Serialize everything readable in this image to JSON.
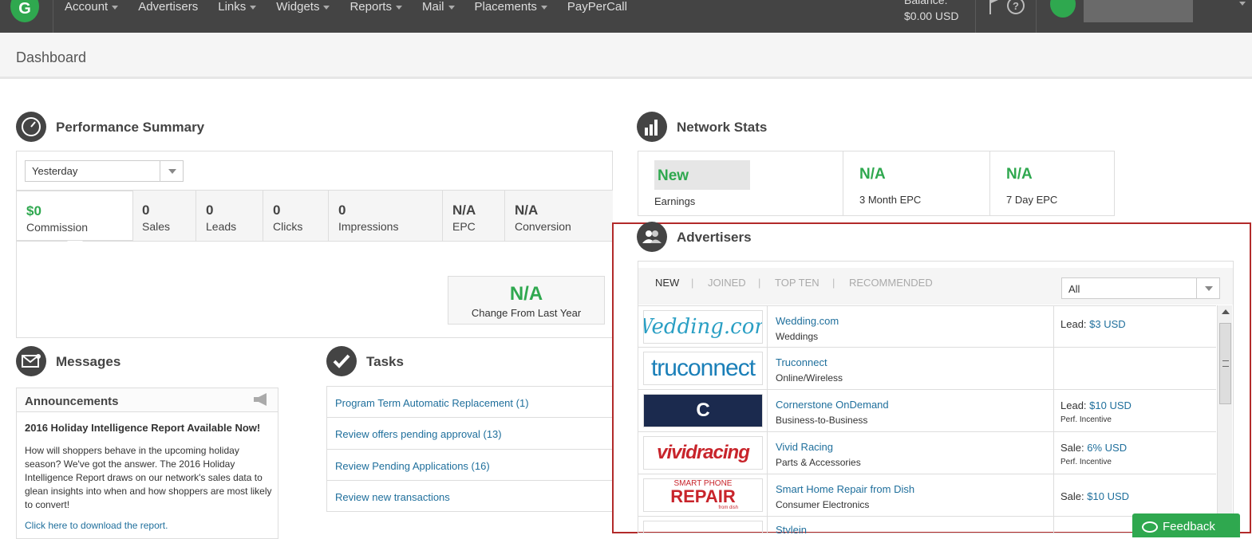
{
  "app": {
    "logo_glyph": "G",
    "brand_color": "#2fa84f"
  },
  "topnav": {
    "items": [
      {
        "label": "Account",
        "dropdown": true
      },
      {
        "label": "Advertisers",
        "dropdown": false
      },
      {
        "label": "Links",
        "dropdown": true
      },
      {
        "label": "Widgets",
        "dropdown": true
      },
      {
        "label": "Reports",
        "dropdown": true
      },
      {
        "label": "Mail",
        "dropdown": true
      },
      {
        "label": "Placements",
        "dropdown": true
      },
      {
        "label": "PayPerCall",
        "dropdown": false
      }
    ],
    "balance_label": "Balance:",
    "balance_value": "$0.00 USD",
    "help_glyph": "?"
  },
  "page": {
    "title": "Dashboard"
  },
  "performance": {
    "title": "Performance Summary",
    "period": "Yesterday",
    "metrics": [
      {
        "value": "$0",
        "label": "Commission",
        "active": true
      },
      {
        "value": "0",
        "label": "Sales"
      },
      {
        "value": "0",
        "label": "Leads"
      },
      {
        "value": "0",
        "label": "Clicks"
      },
      {
        "value": "0",
        "label": "Impressions"
      },
      {
        "value": "N/A",
        "label": "EPC"
      },
      {
        "value": "N/A",
        "label": "Conversion"
      }
    ],
    "change": {
      "value": "N/A",
      "label": "Change From Last Year"
    }
  },
  "network_stats": {
    "title": "Network Stats",
    "cells": [
      {
        "value": "New",
        "label": "Earnings"
      },
      {
        "value": "N/A",
        "label": "3 Month EPC"
      },
      {
        "value": "N/A",
        "label": "7 Day EPC"
      }
    ]
  },
  "messages": {
    "title": "Messages",
    "announcements_title": "Announcements",
    "headline": "2016 Holiday Intelligence Report Available Now!",
    "body": "How will shoppers behave in the upcoming holiday season? We've got the answer. The 2016 Holiday Intelligence Report draws on our network's sales data to glean insights into when and how shoppers are most likely to convert!",
    "link": "Click here to download the report."
  },
  "tasks": {
    "title": "Tasks",
    "items": [
      "Program Term Automatic Replacement (1)",
      "Review offers pending approval (13)",
      "Review Pending Applications (16)",
      "Review new transactions"
    ]
  },
  "advertisers": {
    "title": "Advertisers",
    "tabs": [
      "NEW",
      "JOINED",
      "TOP TEN",
      "RECOMMENDED"
    ],
    "active_tab": "NEW",
    "filter": "All",
    "rows": [
      {
        "logo_text": "Wedding.com",
        "name": "Wedding.com",
        "category": "Weddings",
        "offer_type": "Lead:",
        "offer_amount": "$3 USD",
        "incentive": ""
      },
      {
        "logo_text": "truconnect",
        "name": "Truconnect",
        "category": "Online/Wireless",
        "offer_type": "",
        "offer_amount": "",
        "incentive": ""
      },
      {
        "logo_text": "C",
        "name": "Cornerstone OnDemand",
        "category": "Business-to-Business",
        "offer_type": "Lead:",
        "offer_amount": "$10 USD",
        "incentive": "Perf. Incentive"
      },
      {
        "logo_text": "vividracing",
        "name": "Vivid Racing",
        "category": "Parts & Accessories",
        "offer_type": "Sale:",
        "offer_amount": "6% USD",
        "incentive": "Perf. Incentive"
      },
      {
        "logo_text": "REPAIR",
        "logo_small": "SMART PHONE",
        "logo_tiny": "from dish",
        "name": "Smart Home Repair from Dish",
        "category": "Consumer Electronics",
        "offer_type": "Sale:",
        "offer_amount": "$10 USD",
        "incentive": ""
      },
      {
        "logo_text": "",
        "name": "Stylein",
        "category": "",
        "offer_type": "",
        "offer_amount": "",
        "incentive": ""
      }
    ]
  },
  "feedback": {
    "label": "Feedback"
  }
}
